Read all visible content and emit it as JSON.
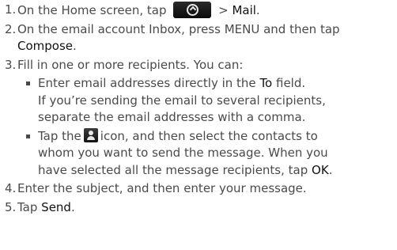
{
  "steps": [
    {
      "num": "1.",
      "before": "On the Home screen, tap",
      "icon": "home-all-apps-icon",
      "after": "> ",
      "kw": "Mail",
      "end": "."
    },
    {
      "num": "2.",
      "line1": "On the email account Inbox, press MENU and then tap",
      "kw": "Compose",
      "end": "."
    },
    {
      "num": "3.",
      "text": "Fill in one or more recipients. You can:",
      "bullets": [
        {
          "line1_before": "Enter email addresses directly in the ",
          "line1_kw": "To",
          "line1_after": " field.",
          "line2": "If you’re sending the email to several recipients,",
          "line3": "separate the email addresses with a comma."
        },
        {
          "line1_before": "Tap the",
          "icon": "contact-person-icon",
          "line1_after": "icon, and then select the contacts to",
          "line2": "whom you want to send the message. When you",
          "line3_before": "have selected all the message recipients, tap ",
          "line3_kw": "OK",
          "line3_after": "."
        }
      ]
    },
    {
      "num": "4.",
      "text": "Enter the subject, and then enter your message."
    },
    {
      "num": "5.",
      "before": "Tap ",
      "kw": "Send",
      "end": "."
    }
  ]
}
